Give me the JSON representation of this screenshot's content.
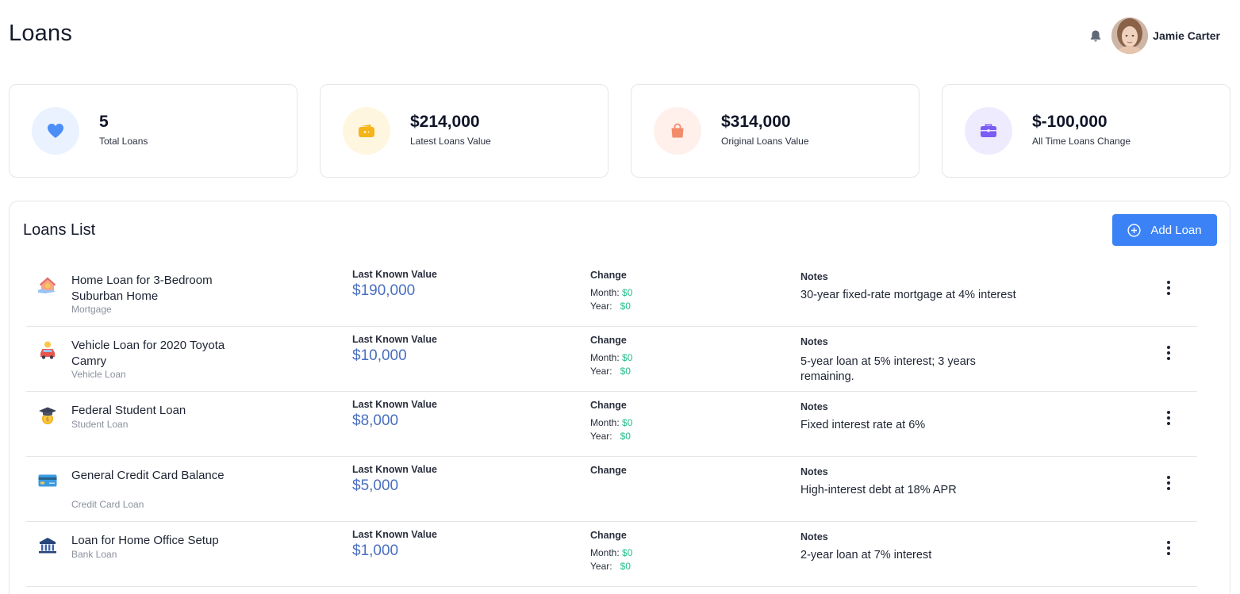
{
  "header": {
    "title": "Loans",
    "user_name": "Jamie Carter",
    "bell_icon": "bell-icon",
    "avatar": "avatar-photo"
  },
  "stats": [
    {
      "value": "5",
      "label": "Total Loans",
      "icon": "heart-icon",
      "color": "#4c8df6",
      "bg": "#ebf2ff"
    },
    {
      "value": "$214,000",
      "label": "Latest Loans Value",
      "icon": "wallet-icon",
      "color": "#f5b51a",
      "bg": "#fff6e0"
    },
    {
      "value": "$314,000",
      "label": "Original Loans Value",
      "icon": "bag-icon",
      "color": "#f28b69",
      "bg": "#fff0ec"
    },
    {
      "value": "$-100,000",
      "label": "All Time Loans Change",
      "icon": "briefcase-icon",
      "color": "#7b5cf5",
      "bg": "#efebff"
    }
  ],
  "list": {
    "title": "Loans List",
    "add_button": "Add Loan",
    "lkv_header": "Last Known Value",
    "change_header": "Change",
    "notes_header": "Notes",
    "month_label": "Month:",
    "year_label": "Year:",
    "rows": [
      {
        "name": "Home Loan for 3-Bedroom Suburban Home",
        "type": "Mortgage",
        "value": "$190,000",
        "month": "$0",
        "year": "$0",
        "notes": "30-year fixed-rate mortgage at 4% interest",
        "icon": "house-hand-icon"
      },
      {
        "name": "Vehicle Loan for 2020 Toyota Camry",
        "type": "Vehicle Loan",
        "value": "$10,000",
        "month": "$0",
        "year": "$0",
        "notes": "5-year loan at 5% interest; 3 years remaining.",
        "icon": "car-coin-icon"
      },
      {
        "name": "Federal Student Loan",
        "type": "Student Loan",
        "value": "$8,000",
        "month": "$0",
        "year": "$0",
        "notes": "Fixed interest rate at 6%",
        "icon": "graduation-coin-icon"
      },
      {
        "name": "General Credit Card Balance",
        "type": "Credit Card Loan",
        "value": "$5,000",
        "month": "",
        "year": "",
        "notes": "High-interest debt at 18% APR",
        "icon": "credit-card-icon"
      },
      {
        "name": "Loan for Home Office Setup",
        "type": "Bank Loan",
        "value": "$1,000",
        "month": "$0",
        "year": "$0",
        "notes": " 2-year loan at 7% interest",
        "icon": "bank-icon"
      }
    ]
  }
}
